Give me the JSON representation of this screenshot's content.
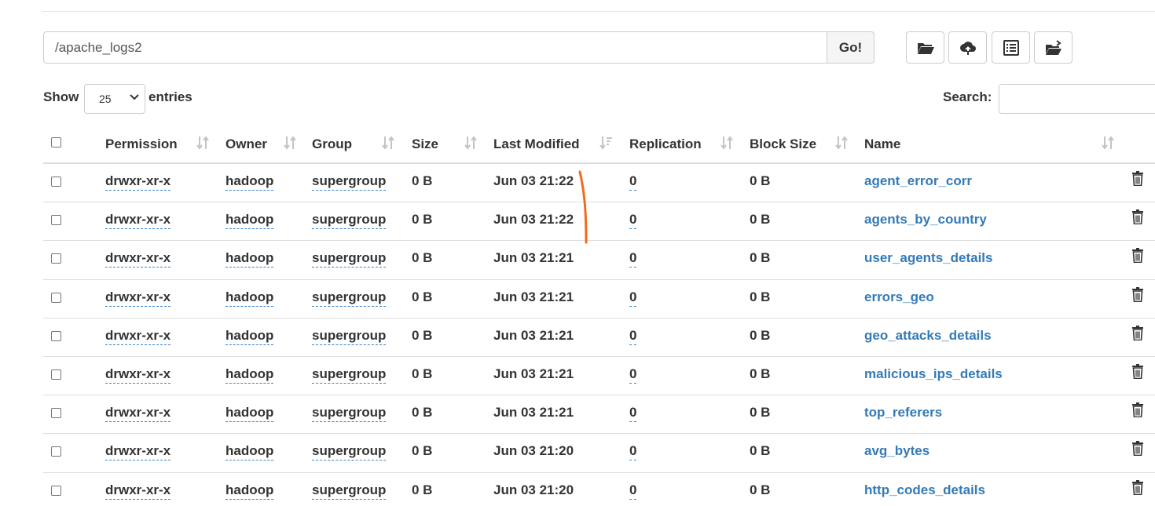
{
  "path": {
    "value": "/apache_logs2",
    "go_label": "Go!"
  },
  "toolbar": {
    "buttons": [
      "folder-open-icon",
      "cloud-upload-icon",
      "list-alt-icon",
      "cut-icon"
    ]
  },
  "length": {
    "show_label": "Show",
    "selected": "25",
    "entries_label": "entries"
  },
  "search": {
    "label": "Search:",
    "value": ""
  },
  "table": {
    "columns": [
      "Permission",
      "Owner",
      "Group",
      "Size",
      "Last Modified",
      "Replication",
      "Block Size",
      "Name"
    ],
    "rows": [
      {
        "permission": "drwxr-xr-x",
        "owner": "hadoop",
        "group": "supergroup",
        "size": "0 B",
        "modified": "Jun 03 21:22",
        "replication": "0",
        "block_size": "0 B",
        "name": "agent_error_corr"
      },
      {
        "permission": "drwxr-xr-x",
        "owner": "hadoop",
        "group": "supergroup",
        "size": "0 B",
        "modified": "Jun 03 21:22",
        "replication": "0",
        "block_size": "0 B",
        "name": "agents_by_country"
      },
      {
        "permission": "drwxr-xr-x",
        "owner": "hadoop",
        "group": "supergroup",
        "size": "0 B",
        "modified": "Jun 03 21:21",
        "replication": "0",
        "block_size": "0 B",
        "name": "user_agents_details"
      },
      {
        "permission": "drwxr-xr-x",
        "owner": "hadoop",
        "group": "supergroup",
        "size": "0 B",
        "modified": "Jun 03 21:21",
        "replication": "0",
        "block_size": "0 B",
        "name": "errors_geo"
      },
      {
        "permission": "drwxr-xr-x",
        "owner": "hadoop",
        "group": "supergroup",
        "size": "0 B",
        "modified": "Jun 03 21:21",
        "replication": "0",
        "block_size": "0 B",
        "name": "geo_attacks_details"
      },
      {
        "permission": "drwxr-xr-x",
        "owner": "hadoop",
        "group": "supergroup",
        "size": "0 B",
        "modified": "Jun 03 21:21",
        "replication": "0",
        "block_size": "0 B",
        "name": "malicious_ips_details"
      },
      {
        "permission": "drwxr-xr-x",
        "owner": "hadoop",
        "group": "supergroup",
        "size": "0 B",
        "modified": "Jun 03 21:21",
        "replication": "0",
        "block_size": "0 B",
        "name": "top_referers"
      },
      {
        "permission": "drwxr-xr-x",
        "owner": "hadoop",
        "group": "supergroup",
        "size": "0 B",
        "modified": "Jun 03 21:20",
        "replication": "0",
        "block_size": "0 B",
        "name": "avg_bytes"
      },
      {
        "permission": "drwxr-xr-x",
        "owner": "hadoop",
        "group": "supergroup",
        "size": "0 B",
        "modified": "Jun 03 21:20",
        "replication": "0",
        "block_size": "0 B",
        "name": "http_codes_details"
      }
    ]
  },
  "colors": {
    "link": "#337ab7",
    "annotation": "#f26b1d",
    "border": "#cccccc"
  }
}
